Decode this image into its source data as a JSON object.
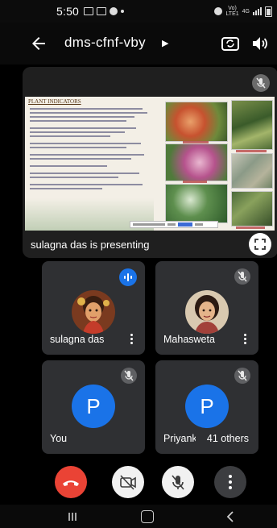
{
  "status_bar": {
    "time": "5:50",
    "network_text_top": "Vo)",
    "network_text_bottom": "LTE1",
    "network_speed": "4G"
  },
  "header": {
    "meeting_code": "dms-cfnf-vby",
    "icons": [
      "back-arrow-icon",
      "chevron-right-icon",
      "switch-camera-icon",
      "speaker-icon"
    ]
  },
  "presentation": {
    "slide_title": "PLANT INDICATORS",
    "presenter_label": "sulagna das is presenting",
    "icons": [
      "mic-off-icon",
      "fullscreen-icon"
    ]
  },
  "participants": [
    {
      "name": "sulagna das",
      "status": "speaking",
      "avatar": "photo"
    },
    {
      "name": "Mahasweta",
      "status": "muted",
      "avatar": "photo"
    },
    {
      "name": "You",
      "status": "muted",
      "avatar": "letter",
      "initial": "P"
    },
    {
      "name": "Priyanka",
      "status": "muted",
      "avatar": "letter",
      "initial": "P",
      "others_count_label": "41 others"
    }
  ],
  "controls": {
    "items": [
      "end-call-icon",
      "video-off-icon",
      "mic-off-icon",
      "more-vertical-icon"
    ]
  },
  "colors": {
    "background": "#000000",
    "tile": "#2f3033",
    "accent_blue": "#1a73e8",
    "hangup_red": "#ea4335"
  }
}
